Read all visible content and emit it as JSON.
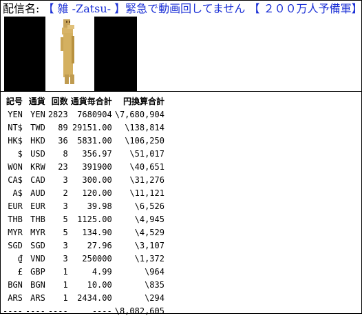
{
  "header": {
    "label": "配信名:",
    "title": "【 雑 -Zatsu- 】緊急で動画回してません 【 ２００万人予備軍】"
  },
  "images": [
    {
      "name": "black-thumbnail-1"
    },
    {
      "name": "character-thumbnail"
    },
    {
      "name": "black-thumbnail-2"
    }
  ],
  "table": {
    "headers": [
      "記号",
      "通貨",
      "回数",
      "通貨毎合計",
      "円換算合計"
    ],
    "rows": [
      [
        "YEN",
        "YEN",
        "2823",
        "7680904",
        "\\7,680,904"
      ],
      [
        "NT$",
        "TWD",
        "89",
        "29151.00",
        "\\138,814"
      ],
      [
        "HK$",
        "HKD",
        "36",
        "5831.00",
        "\\106,250"
      ],
      [
        "$",
        "USD",
        "8",
        "356.97",
        "\\51,017"
      ],
      [
        "WON",
        "KRW",
        "23",
        "391900",
        "\\40,651"
      ],
      [
        "CA$",
        "CAD",
        "3",
        "300.00",
        "\\31,276"
      ],
      [
        "A$",
        "AUD",
        "2",
        "120.00",
        "\\11,121"
      ],
      [
        "EUR",
        "EUR",
        "3",
        "39.98",
        "\\6,526"
      ],
      [
        "THB",
        "THB",
        "5",
        "1125.00",
        "\\4,945"
      ],
      [
        "MYR",
        "MYR",
        "5",
        "134.90",
        "\\4,529"
      ],
      [
        "SGD",
        "SGD",
        "3",
        "27.96",
        "\\3,107"
      ],
      [
        "₫",
        "VND",
        "3",
        "250000",
        "\\1,372"
      ],
      [
        "£",
        "GBP",
        "1",
        "4.99",
        "\\964"
      ],
      [
        "BGN",
        "BGN",
        "1",
        "10.00",
        "\\835"
      ],
      [
        "ARS",
        "ARS",
        "1",
        "2434.00",
        "\\294"
      ]
    ],
    "total": [
      "----",
      "----",
      "----",
      "----",
      "\\8,082,605"
    ]
  }
}
